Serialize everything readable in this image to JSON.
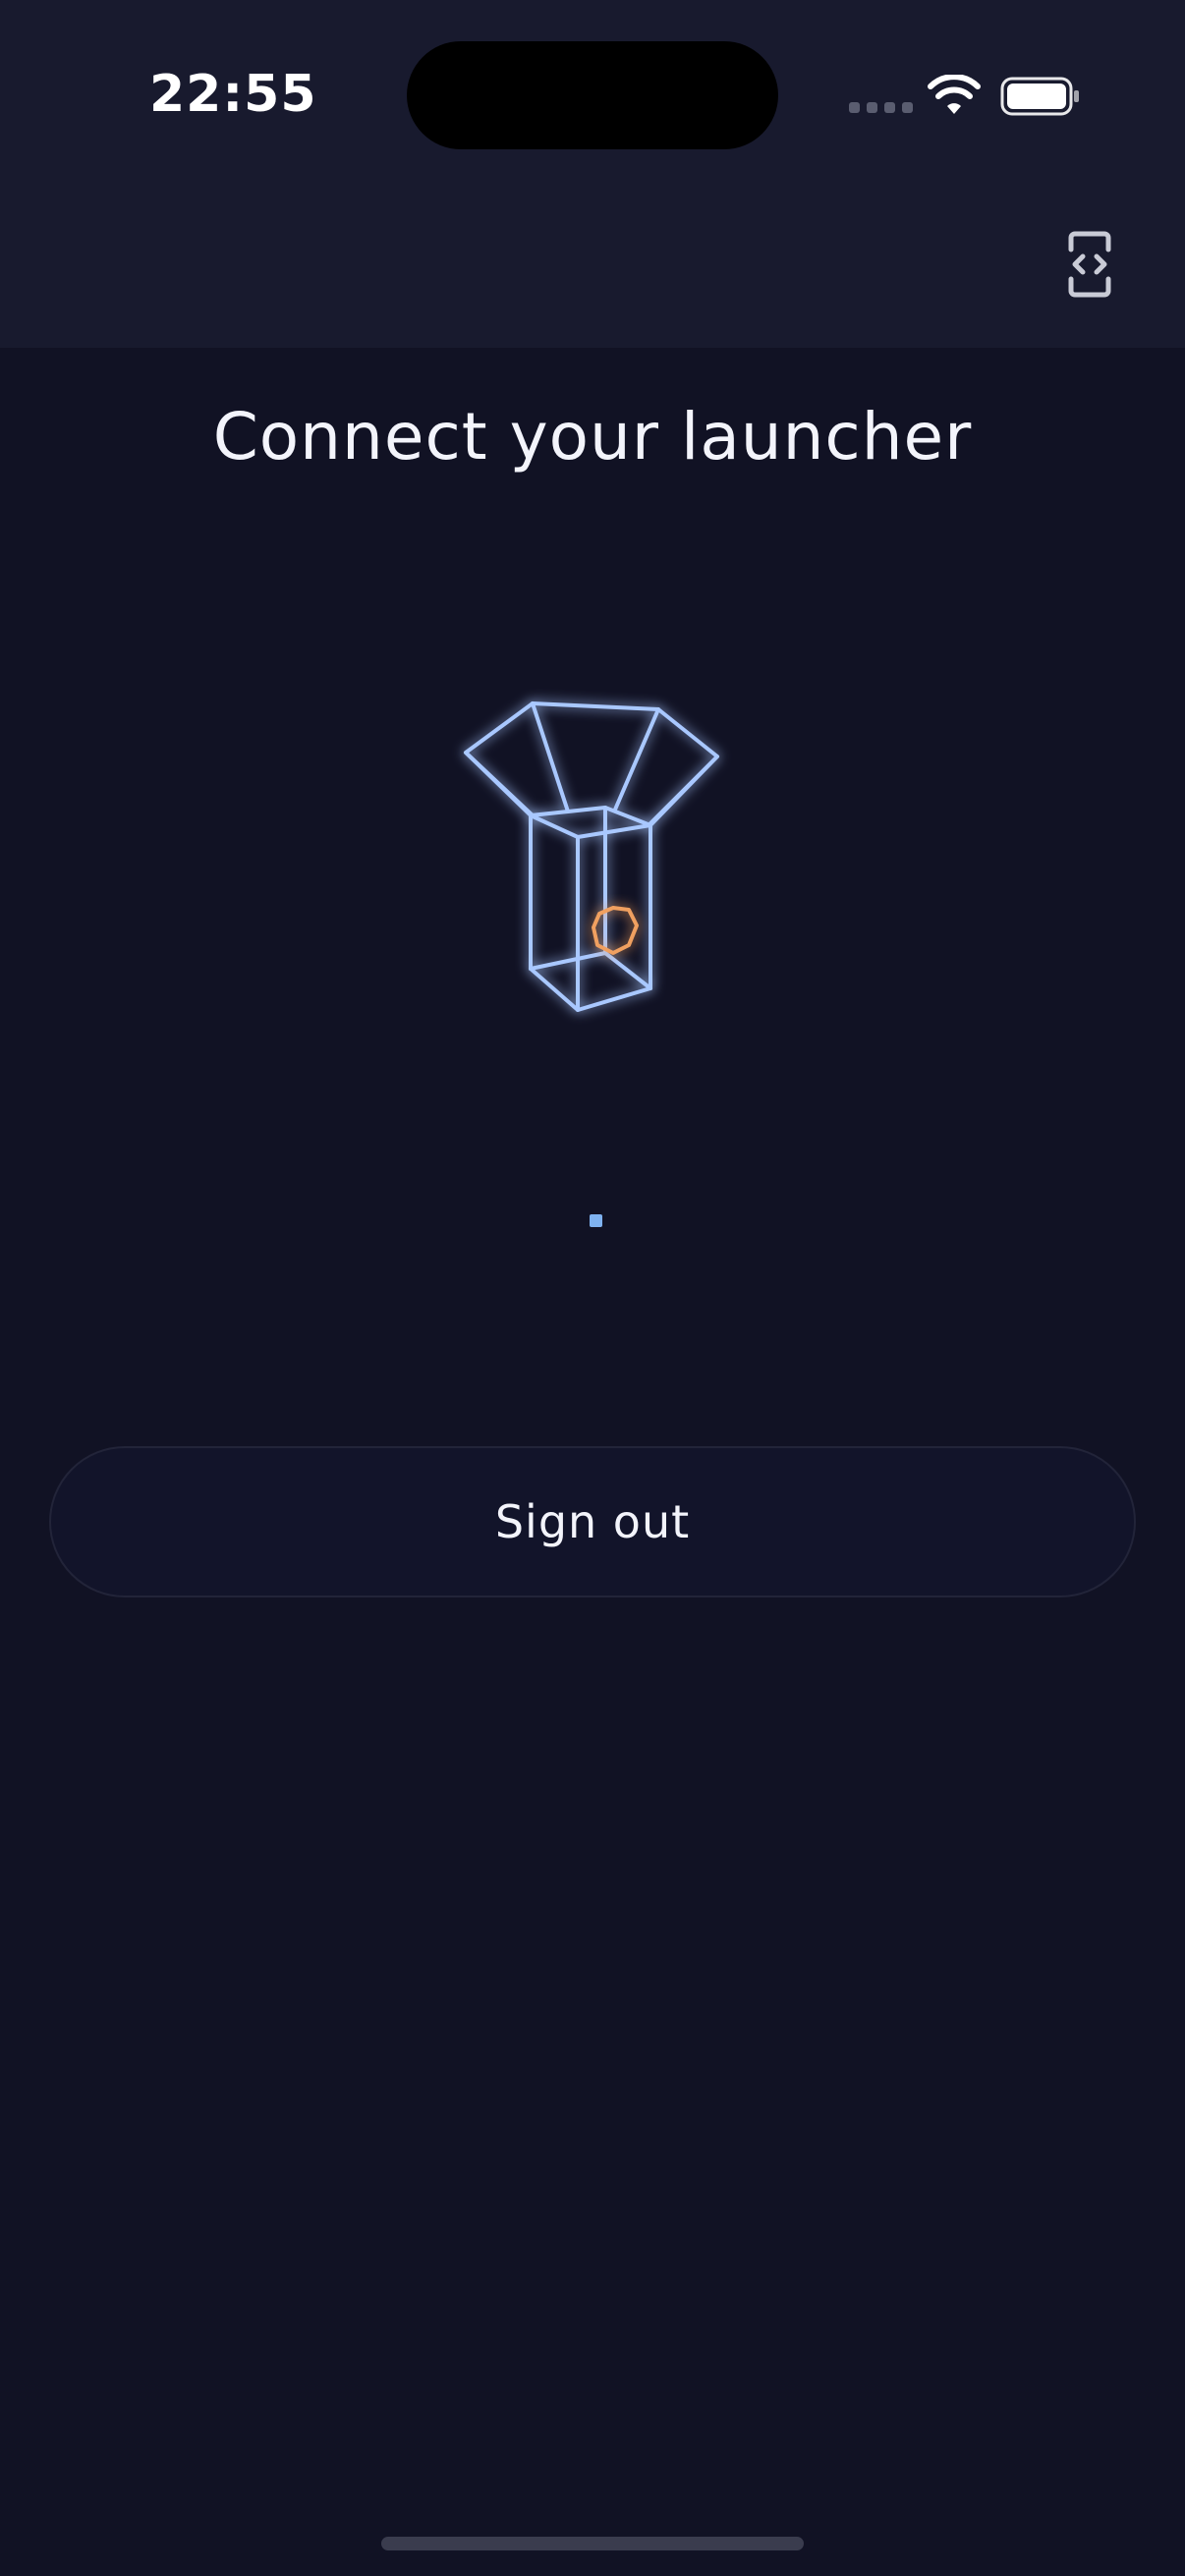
{
  "status_bar": {
    "time": "22:55",
    "icons": [
      "cellular-signal-icon",
      "wifi-icon",
      "battery-icon"
    ]
  },
  "header": {
    "debug_icon": "code-brackets-phone-icon"
  },
  "main": {
    "title": "Connect your launcher",
    "illustration": "wireframe-launcher-box-icon",
    "loading_indicator": "loading-dot",
    "signout_label": "Sign out"
  },
  "colors": {
    "background": "#111224",
    "header_background": "#181a2e",
    "wireframe_blue": "#a9c8ff",
    "accent_orange": "#f0a060",
    "loader_blue": "#7fb2f0"
  }
}
